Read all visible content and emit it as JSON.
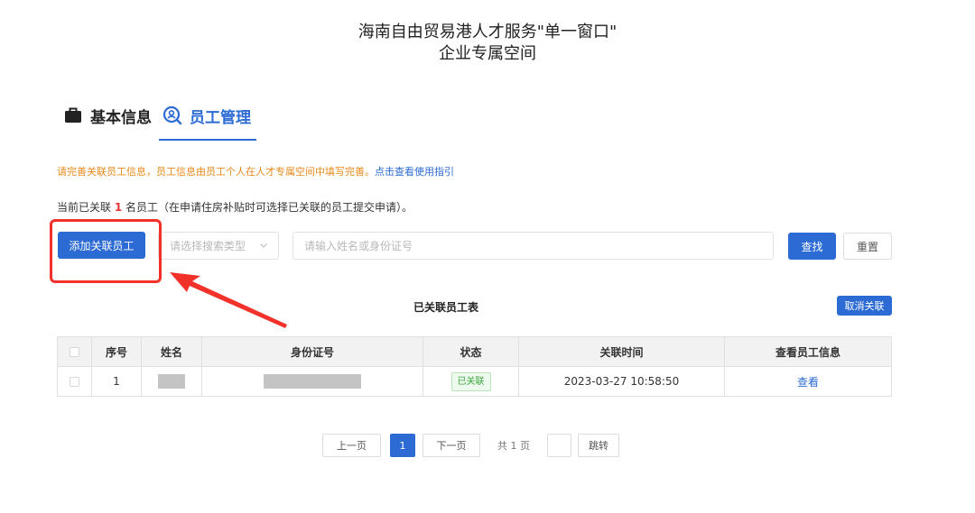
{
  "header": {
    "title_line1": "海南自由贸易港人才服务\"单一窗口\"",
    "title_line2": "企业专属空间"
  },
  "tabs": [
    {
      "label": "基本信息",
      "icon": "briefcase-icon",
      "active": false
    },
    {
      "label": "员工管理",
      "icon": "search-people-icon",
      "active": true
    }
  ],
  "notice": {
    "text": "请完善关联员工信息，员工信息由员工个人在人才专属空间中填写完善。",
    "link": "点击查看使用指引"
  },
  "count_line": {
    "prefix": "当前已关联 ",
    "count": "1",
    "suffix": " 名员工（在申请住房补贴时可选择已关联的员工提交申请）。"
  },
  "toolbar": {
    "add_label": "添加关联员工",
    "select_placeholder": "请选择搜索类型",
    "search_placeholder": "请输入姓名或身份证号",
    "search_label": "查找",
    "reset_label": "重置"
  },
  "table": {
    "title": "已关联员工表",
    "cancel_label": "取消关联",
    "columns": [
      "序号",
      "姓名",
      "身份证号",
      "状态",
      "关联时间",
      "查看员工信息"
    ],
    "rows": [
      {
        "index": "1",
        "status": "已关联",
        "time": "2023-03-27 10:58:50",
        "action": "查看"
      }
    ]
  },
  "pagination": {
    "prev_label": "上一页",
    "current_page": "1",
    "next_label": "下一页",
    "total_label": "共 1 页",
    "go_label": "跳转"
  },
  "colors": {
    "primary": "#2c6bd3",
    "notice": "#e88a1b",
    "highlight": "#f2322a",
    "status_green": "#3aa53a"
  }
}
